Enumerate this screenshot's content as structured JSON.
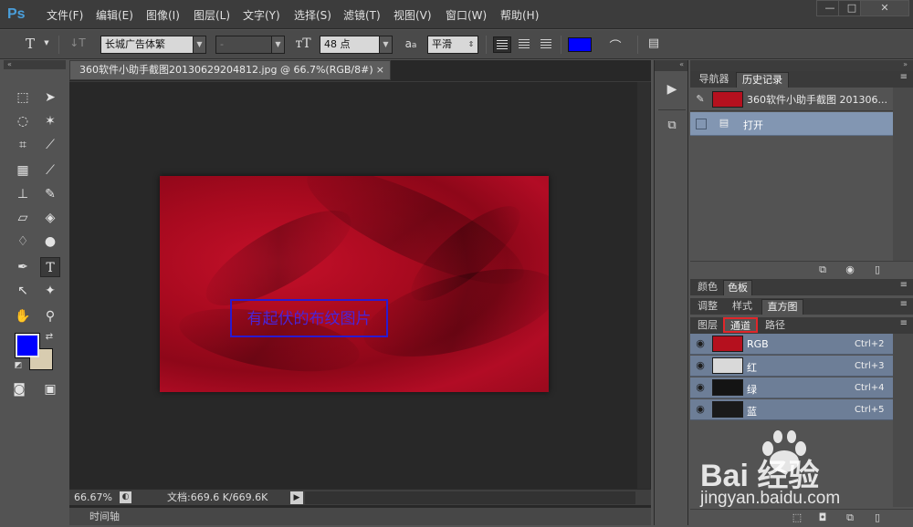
{
  "app": {
    "logo": "Ps"
  },
  "menu": [
    "文件(F)",
    "编辑(E)",
    "图像(I)",
    "图层(L)",
    "文字(Y)",
    "选择(S)",
    "滤镜(T)",
    "视图(V)",
    "窗口(W)",
    "帮助(H)"
  ],
  "window_controls": {
    "minimize": "—",
    "restore": "□",
    "close": "✕"
  },
  "options": {
    "font_family": "长城广告体繁",
    "font_style": "-",
    "font_size": "48 点",
    "aa_label": "a",
    "antialias": "平滑",
    "color": "#0000ff"
  },
  "document": {
    "tab_title": "360软件小助手截图20130629204812.jpg @ 66.7%(RGB/8#)",
    "tab_close": "×",
    "canvas_text": "有起伏的布纹图片",
    "zoom": "66.67%",
    "doc_info": "文档:669.6 K/669.6K",
    "timeline": "时间轴"
  },
  "panels": {
    "top_tabs": [
      "导航器",
      "历史记录"
    ],
    "history_snapshot": "360软件小助手截图 201306...",
    "history_items": [
      "打开"
    ],
    "color_tabs": [
      "颜色",
      "色板"
    ],
    "adjust_tabs": [
      "调整",
      "样式",
      "直方图"
    ],
    "layer_tabs": [
      "图层",
      "通道",
      "路径"
    ],
    "channels": [
      {
        "name": "RGB",
        "shortcut": "Ctrl+2",
        "thumb": "#b5101e"
      },
      {
        "name": "红",
        "shortcut": "Ctrl+3",
        "thumb": "#d9d9d9"
      },
      {
        "name": "绿",
        "shortcut": "Ctrl+4",
        "thumb": "#141414"
      },
      {
        "name": "蓝",
        "shortcut": "Ctrl+5",
        "thumb": "#1a1a1a"
      }
    ]
  },
  "watermark": {
    "brand": "Bai 经验",
    "url": "jingyan.baidu.com"
  },
  "colors": {
    "foreground": "#0000ff",
    "background": "#d8ccb0",
    "accent_highlight": "#e0262a"
  }
}
